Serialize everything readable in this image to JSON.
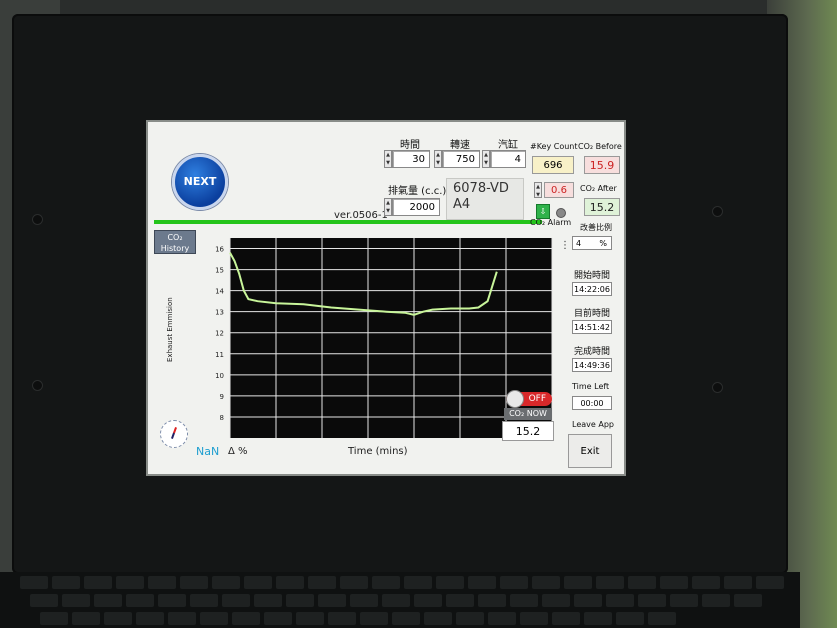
{
  "header": {
    "logo_text": "NEXT",
    "version": "ver.0506-1",
    "vehicle": {
      "plate": "6078-VD",
      "slot": "A4"
    }
  },
  "inputs": {
    "time": {
      "label": "時間",
      "value": "30"
    },
    "rpm": {
      "label": "轉速",
      "value": "750"
    },
    "cylinders": {
      "label": "汽缸",
      "value": "4"
    },
    "displacement": {
      "label": "排氣量 (c.c.)",
      "value": "2000"
    },
    "alarm_threshold": {
      "value": "0.6"
    }
  },
  "key_count": {
    "label": "#Key Count",
    "value": "696"
  },
  "co2_before": {
    "label": "CO₂ Before",
    "value": "15.9"
  },
  "co2_after": {
    "label": "CO₂ After",
    "value": "15.2"
  },
  "alarm": {
    "label": "CO₂ Alarm"
  },
  "ratio": {
    "label": "改善比例",
    "value": "4",
    "unit": "%"
  },
  "times": {
    "start": {
      "label": "開始時間",
      "value": "14:22:06"
    },
    "current": {
      "label": "目前時間",
      "value": "14:51:42"
    },
    "finish": {
      "label": "完成時間",
      "value": "14:49:36"
    },
    "left": {
      "label": "Time Left",
      "value": "00:00"
    }
  },
  "leave": {
    "label": "Leave App",
    "button": "Exit"
  },
  "history_button": "CO₂ History",
  "status": {
    "nan": "NaN",
    "delta": "Δ %"
  },
  "co2_now": {
    "toggle": "OFF",
    "label": "CO₂ NOW",
    "value": "15.2"
  },
  "colors": {
    "trace": "#c8f59a",
    "plot_bg": "#0a0a0a",
    "accent_green": "#24c41a"
  },
  "chart_data": {
    "type": "line",
    "xlabel": "Time (mins)",
    "ylabel": "Exhaust Emmision",
    "ylim": [
      7,
      16.5
    ],
    "xlim": [
      0,
      35
    ],
    "yticks": [
      8,
      9,
      10,
      11,
      12,
      13,
      14,
      15,
      16
    ],
    "grid": true,
    "series": [
      {
        "values_x": [
          0,
          0.5,
          1,
          1.5,
          2,
          3,
          5,
          8,
          11,
          14,
          17,
          19,
          20,
          21,
          22,
          24,
          26,
          27,
          28,
          28.5,
          29
        ],
        "values_y": [
          15.8,
          15.4,
          14.8,
          14.0,
          13.6,
          13.5,
          13.4,
          13.35,
          13.2,
          13.1,
          13.0,
          12.95,
          12.85,
          13.0,
          13.1,
          13.15,
          13.15,
          13.2,
          13.5,
          14.2,
          14.9
        ]
      }
    ]
  }
}
